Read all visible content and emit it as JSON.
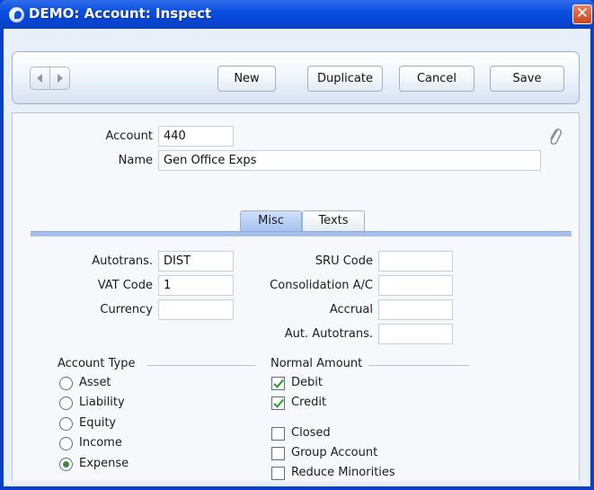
{
  "window": {
    "title": "DEMO: Account: Inspect",
    "close_glyph": "✕"
  },
  "toolbar": {
    "prev_icon": "arrow-left-icon",
    "next_icon": "arrow-right-icon",
    "new_label": "New",
    "duplicate_label": "Duplicate",
    "cancel_label": "Cancel",
    "save_label": "Save"
  },
  "header": {
    "account_label": "Account",
    "account_value": "440",
    "name_label": "Name",
    "name_value": "Gen Office Exps",
    "attachment_icon": "paperclip-icon"
  },
  "tabs": [
    {
      "label": "Misc",
      "active": true
    },
    {
      "label": "Texts",
      "active": false
    }
  ],
  "misc": {
    "autotrans_label": "Autotrans.",
    "autotrans_value": "DIST",
    "vat_code_label": "VAT Code",
    "vat_code_value": "1",
    "currency_label": "Currency",
    "currency_value": "",
    "sru_code_label": "SRU Code",
    "sru_code_value": "",
    "consolidation_label": "Consolidation A/C",
    "consolidation_value": "",
    "accrual_label": "Accrual",
    "accrual_value": "",
    "aut_autotrans_label": "Aut. Autotrans.",
    "aut_autotrans_value": ""
  },
  "account_type": {
    "title": "Account Type",
    "options": [
      {
        "label": "Asset",
        "selected": false
      },
      {
        "label": "Liability",
        "selected": false
      },
      {
        "label": "Equity",
        "selected": false
      },
      {
        "label": "Income",
        "selected": false
      },
      {
        "label": "Expense",
        "selected": true
      }
    ]
  },
  "normal_amount": {
    "title": "Normal Amount",
    "debit_label": "Debit",
    "debit_checked": true,
    "credit_label": "Credit",
    "credit_checked": true
  },
  "flags": {
    "closed_label": "Closed",
    "closed_checked": false,
    "group_account_label": "Group Account",
    "group_account_checked": false,
    "reduce_minorities_label": "Reduce Minorities",
    "reduce_minorities_checked": false
  },
  "colors": {
    "title_bar": "#0a50e0",
    "tab_active": "#a7c3ef",
    "check_mark": "#21a121"
  }
}
